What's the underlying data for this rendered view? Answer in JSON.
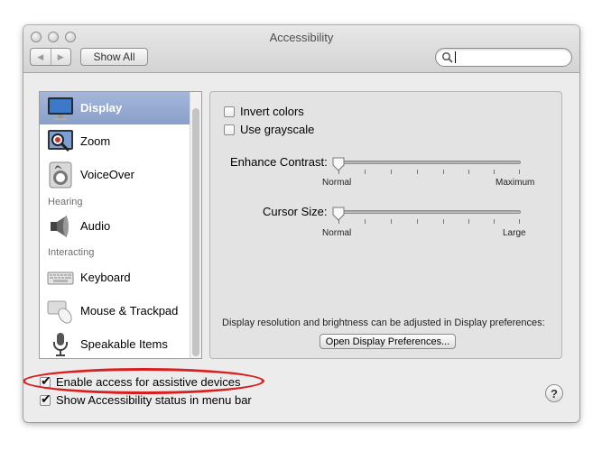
{
  "window": {
    "title": "Accessibility"
  },
  "toolbar": {
    "back_icon": "◀",
    "forward_icon": "▶",
    "show_all_label": "Show All",
    "search_value": ""
  },
  "sidebar": {
    "items": [
      {
        "label": "Display",
        "icon": "display-icon",
        "selected": true
      },
      {
        "label": "Zoom",
        "icon": "zoom-icon"
      },
      {
        "label": "VoiceOver",
        "icon": "voiceover-icon"
      },
      {
        "label": "Audio",
        "icon": "speaker-icon"
      },
      {
        "label": "Keyboard",
        "icon": "keyboard-icon"
      },
      {
        "label": "Mouse & Trackpad",
        "icon": "mouse-icon"
      },
      {
        "label": "Speakable Items",
        "icon": "microphone-icon"
      }
    ],
    "headers": {
      "hearing": "Hearing",
      "interacting": "Interacting"
    }
  },
  "display_pane": {
    "invert_colors": {
      "label": "Invert colors",
      "checked": false
    },
    "use_grayscale": {
      "label": "Use grayscale",
      "checked": false
    },
    "enhance_contrast": {
      "label": "Enhance Contrast:",
      "min_label": "Normal",
      "max_label": "Maximum",
      "value_fraction": 0
    },
    "cursor_size": {
      "label": "Cursor Size:",
      "min_label": "Normal",
      "max_label": "Large",
      "value_fraction": 0
    },
    "info_text": "Display resolution and brightness can be adjusted in Display preferences:",
    "open_prefs_button": "Open Display Preferences..."
  },
  "footer": {
    "enable_access": {
      "label": "Enable access for assistive devices",
      "checked": true
    },
    "show_status": {
      "label": "Show Accessibility status in menu bar",
      "checked": true
    },
    "help_label": "?"
  },
  "colors": {
    "highlight": "#d91f1f",
    "selection": "#8aa0ca"
  }
}
